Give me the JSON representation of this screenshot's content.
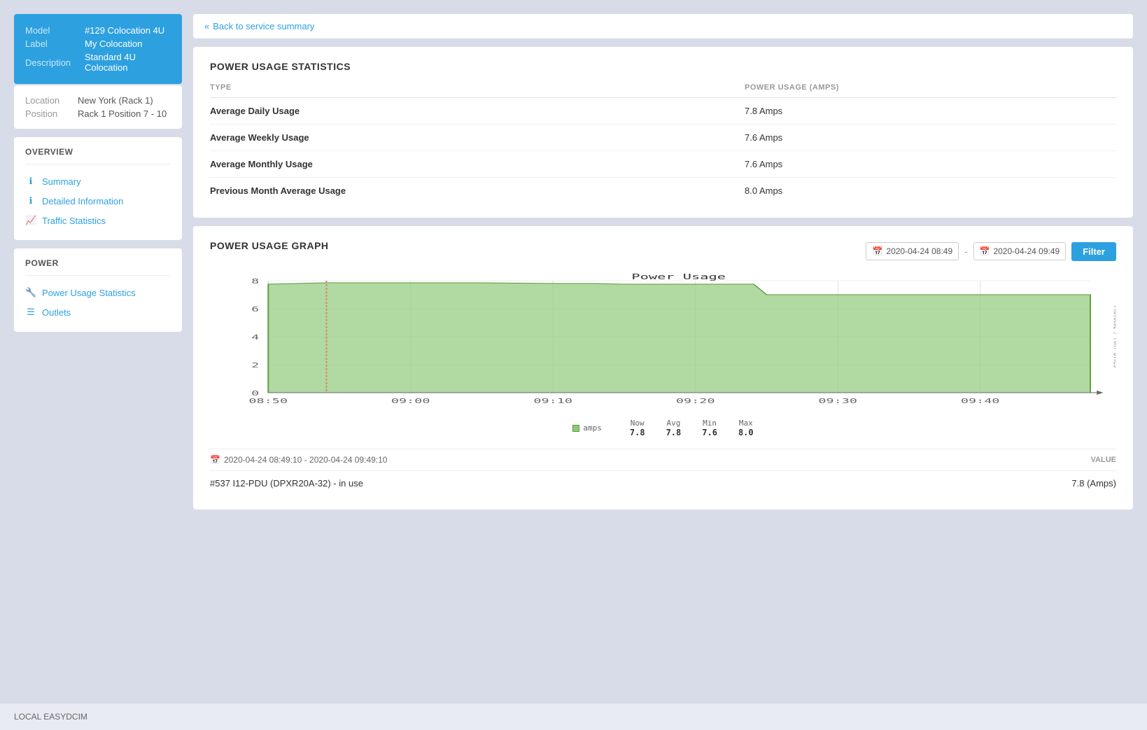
{
  "sidebar": {
    "device": {
      "model_label": "Model",
      "model_value": "#129 Colocation 4U",
      "label_label": "Label",
      "label_value": "My Colocation",
      "description_label": "Description",
      "description_value": "Standard 4U Colocation"
    },
    "location": {
      "location_label": "Location",
      "location_value": "New York (Rack 1)",
      "position_label": "Position",
      "position_value": "Rack 1 Position 7 - 10"
    },
    "overview": {
      "title": "OVERVIEW",
      "items": [
        {
          "label": "Summary",
          "icon": "ℹ"
        },
        {
          "label": "Detailed Information",
          "icon": "ℹ"
        },
        {
          "label": "Traffic Statistics",
          "icon": "📈"
        }
      ]
    },
    "power": {
      "title": "POWER",
      "items": [
        {
          "label": "Power Usage Statistics",
          "icon": "🔧"
        },
        {
          "label": "Outlets",
          "icon": "☰"
        }
      ]
    }
  },
  "back_link": "Back to service summary",
  "power_usage_stats": {
    "title": "POWER USAGE STATISTICS",
    "col1": "TYPE",
    "col2": "POWER USAGE (AMPS)",
    "rows": [
      {
        "type": "Average Daily Usage",
        "value": "7.8 Amps"
      },
      {
        "type": "Average Weekly Usage",
        "value": "7.6 Amps"
      },
      {
        "type": "Average Monthly Usage",
        "value": "7.6 Amps"
      },
      {
        "type": "Previous Month Average Usage",
        "value": "8.0 Amps"
      }
    ]
  },
  "power_usage_graph": {
    "title": "POWER USAGE GRAPH",
    "date_from": "2020-04-24 08:49",
    "date_to": "2020-04-24 09:49",
    "filter_label": "Filter",
    "chart_title": "Power Usage",
    "y_label": "PROTOCOL / PORT BYTES",
    "x_labels": [
      "08:50",
      "09:00",
      "09:10",
      "09:20",
      "09:30",
      "09:40"
    ],
    "y_labels": [
      "0",
      "2",
      "4",
      "6",
      "8"
    ],
    "legend": {
      "color_label": "amps",
      "now_label": "Now",
      "now_value": "7.8",
      "avg_label": "Avg",
      "avg_value": "7.8",
      "min_label": "Min",
      "min_value": "7.6",
      "max_label": "Max",
      "max_value": "8.0"
    },
    "data_range": "2020-04-24 08:49:10 - 2020-04-24 09:49:10",
    "value_col": "VALUE",
    "data_row_label": "#537 I12-PDU (DPXR20A-32) - in use",
    "data_row_value": "7.8 (Amps)"
  },
  "footer": {
    "text": "LOCAL EASYDCIM"
  }
}
